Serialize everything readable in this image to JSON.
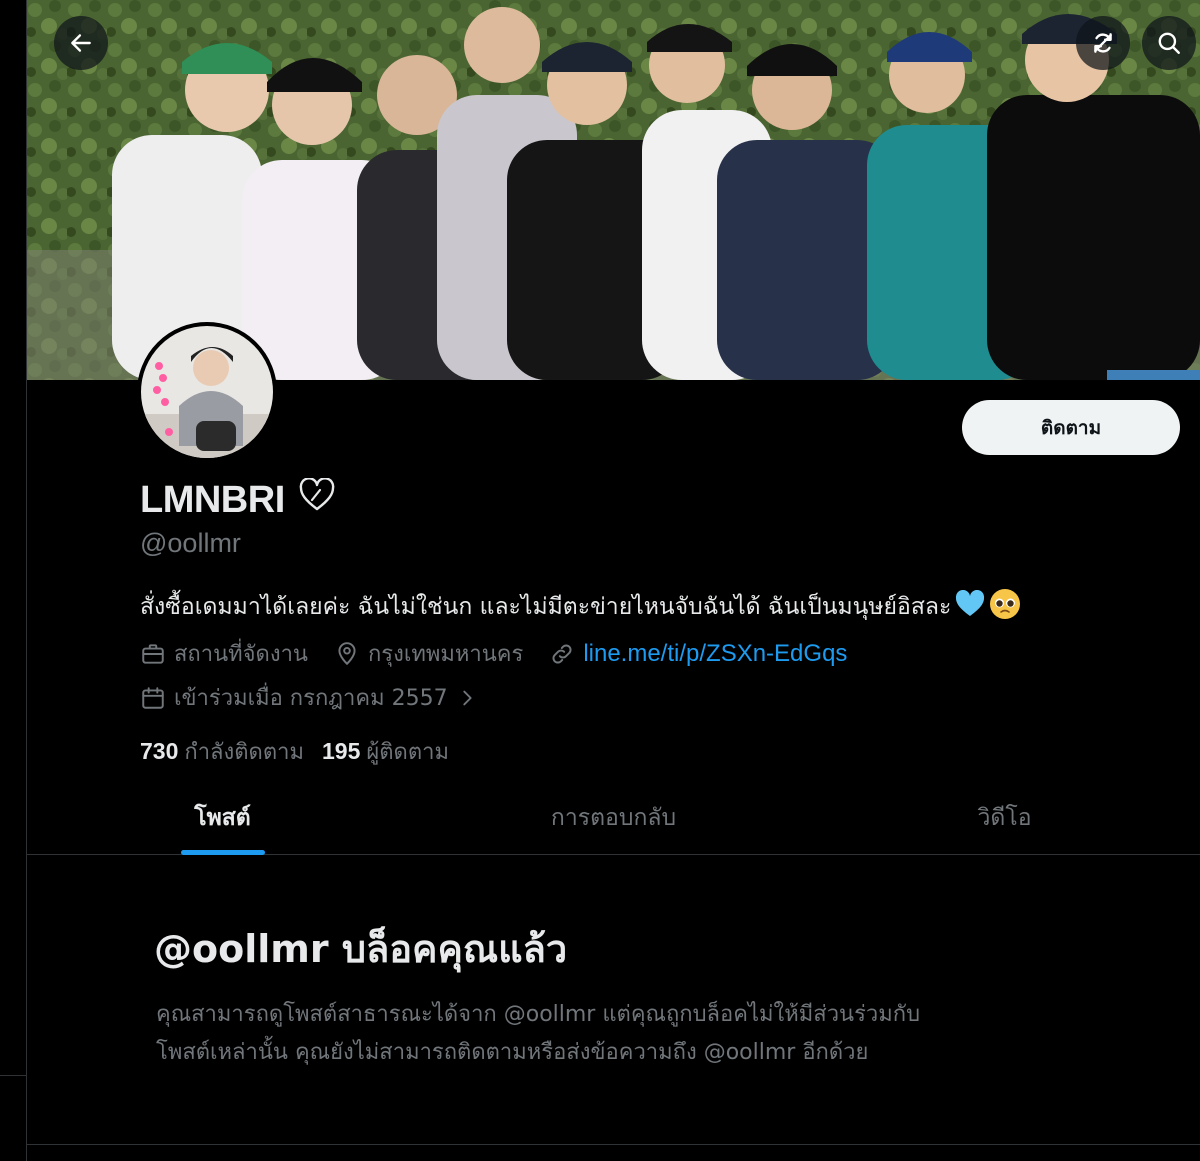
{
  "header": {
    "back_icon": "arrow-left-icon",
    "refresh_icon": "refresh-icon",
    "search_icon": "search-icon"
  },
  "profile": {
    "display_name": "LMNBRI",
    "name_badge_icon": "heart-outline-icon",
    "handle": "@oollmr",
    "follow_label": "ติดตาม",
    "bio_text": "สั่งซื้อเดมมาได้เลยค่ะ ฉันไม่ใช่นก และไม่มีตะข่ายไหนจับฉันได้ ฉันเป็นมนุษย์อิสละ",
    "bio_emojis": [
      "light-blue-heart",
      "pleading-face"
    ],
    "job": "สถานที่จัดงาน",
    "location": "กรุงเทพมหานคร",
    "link": "line.me/ti/p/ZSXn-EdGqs",
    "joined": "เข้าร่วมเมื่อ กรกฎาคม 2557",
    "following_count": "730",
    "following_label": "กำลังติดตาม",
    "followers_count": "195",
    "followers_label": "ผู้ติดตาม"
  },
  "tabs": [
    {
      "label": "โพสต์",
      "active": true
    },
    {
      "label": "การตอบกลับ",
      "active": false
    },
    {
      "label": "วิดีโอ",
      "active": false
    }
  ],
  "blocked": {
    "title": "@oollmr บล็อคคุณแล้ว",
    "line1": "คุณสามารถดูโพสต์สาธารณะได้จาก @oollmr แต่คุณถูกบล็อคไม่ให้มีส่วนร่วมกับ",
    "line2": "โพสต์เหล่านั้น คุณยังไม่สามารถติดตามหรือส่งข้อความถึง @oollmr อีกด้วย"
  },
  "colors": {
    "background": "#000000",
    "text_primary": "#e7e9ea",
    "text_secondary": "#71767b",
    "accent": "#1d9bf0",
    "follow_button_bg": "#eff3f4"
  }
}
